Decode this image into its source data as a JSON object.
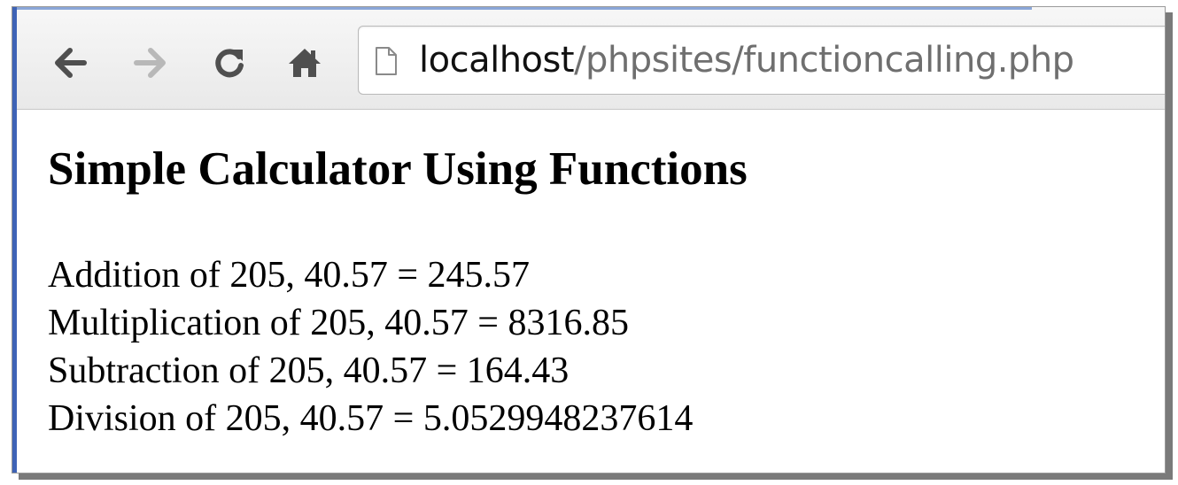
{
  "browser": {
    "url_host": "localhost",
    "url_path": "/phpsites/functioncalling.php",
    "icons": {
      "back": "arrow-left-icon",
      "forward": "arrow-right-icon",
      "reload": "reload-icon",
      "home": "home-icon",
      "page": "document-icon"
    }
  },
  "page": {
    "title": "Simple Calculator Using Functions",
    "results": [
      "Addition of 205, 40.57 = 245.57",
      "Multiplication of 205, 40.57 = 8316.85",
      "Subtraction of 205, 40.57 = 164.43",
      "Division of 205, 40.57 = 5.0529948237614"
    ]
  },
  "colors": {
    "window_accent": "#3e63b6",
    "icon_active": "#4f4f4f",
    "icon_disabled": "#b8b8b8",
    "url_host": "#111111",
    "url_path": "#6f6f6f"
  }
}
